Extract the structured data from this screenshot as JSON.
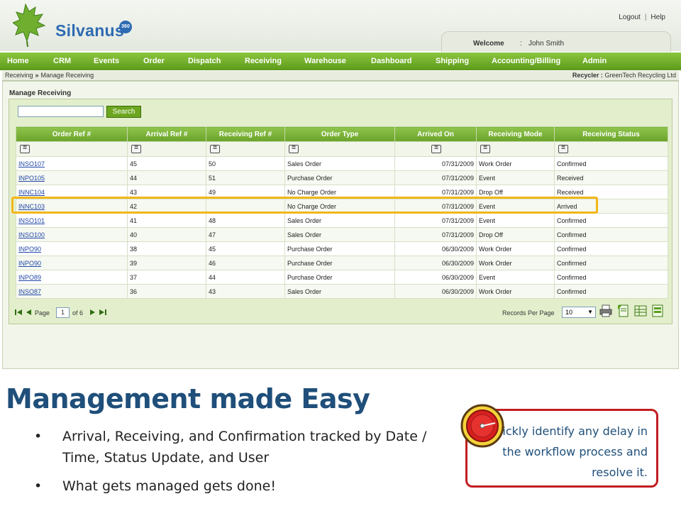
{
  "app": {
    "logo_text": "Silvanus",
    "logo_badge": "360",
    "top_links": {
      "logout": "Logout",
      "separator": "|",
      "help": "Help"
    },
    "welcome": {
      "label": "Welcome",
      "colon": ":",
      "user": "John Smith"
    },
    "nav": [
      "Home",
      "CRM",
      "Events",
      "Order",
      "Dispatch",
      "Receiving",
      "Warehouse",
      "Dashboard",
      "Shipping",
      "Accounting/Billing",
      "Admin"
    ],
    "breadcrumb": {
      "parent": "Receiving",
      "separator": "»",
      "current": "Manage Receiving"
    },
    "recycler": {
      "label": "Recycler :",
      "value": "GreenTech Recycling Ltd"
    },
    "panel_title": "Manage Receiving",
    "search": {
      "value": "",
      "button": "Search"
    },
    "filter_button": "=",
    "columns": [
      "Order Ref #",
      "Arrival Ref #",
      "Receiving Ref #",
      "Order Type",
      "Arrived On",
      "Receiving Mode",
      "Receiving Status"
    ],
    "rows": [
      [
        "INSO107",
        "45",
        "50",
        "Sales Order",
        "07/31/2009",
        "Work Order",
        "Confirmed"
      ],
      [
        "INPO105",
        "44",
        "51",
        "Purchase Order",
        "07/31/2009",
        "Event",
        "Received"
      ],
      [
        "INNC104",
        "43",
        "49",
        "No Charge Order",
        "07/31/2009",
        "Drop Off",
        "Received"
      ],
      [
        "INNC103",
        "42",
        "",
        "No Charge Order",
        "07/31/2009",
        "Event",
        "Arrived"
      ],
      [
        "INSO101",
        "41",
        "48",
        "Sales Order",
        "07/31/2009",
        "Event",
        "Confirmed"
      ],
      [
        "INSO100",
        "40",
        "47",
        "Sales Order",
        "07/31/2009",
        "Drop Off",
        "Confirmed"
      ],
      [
        "INPO90",
        "38",
        "45",
        "Purchase Order",
        "06/30/2009",
        "Work Order",
        "Confirmed"
      ],
      [
        "INPO90",
        "39",
        "46",
        "Purchase Order",
        "06/30/2009",
        "Work Order",
        "Confirmed"
      ],
      [
        "INPO89",
        "37",
        "44",
        "Purchase Order",
        "06/30/2009",
        "Event",
        "Confirmed"
      ],
      [
        "INSO87",
        "36",
        "43",
        "Sales Order",
        "06/30/2009",
        "Work Order",
        "Confirmed"
      ]
    ],
    "highlighted_row_ref": "INNC103",
    "pager": {
      "page_label": "Page",
      "page": "1",
      "of_label": "of 6"
    },
    "records_per_page": {
      "label": "Records Per Page",
      "value": "10"
    },
    "export_icons": [
      "print-icon",
      "export-pdf-icon",
      "export-excel-icon",
      "export-csv-icon"
    ]
  },
  "slide": {
    "title": "Management made Easy",
    "bullets": [
      "Arrival, Receiving, and Confirmation tracked by Date / Time, Status Update, and User",
      "What gets managed gets done!"
    ],
    "bullet_glyph": "•",
    "callout": "Quickly identify any delay in the workflow process and resolve it."
  },
  "colors": {
    "nav_green": "#6aa32a",
    "grid_header": "#7bb23a",
    "link_blue": "#2148a8",
    "highlight_orange": "#f2b619",
    "title_blue": "#1f4f7a",
    "callout_red": "#c21e22"
  }
}
